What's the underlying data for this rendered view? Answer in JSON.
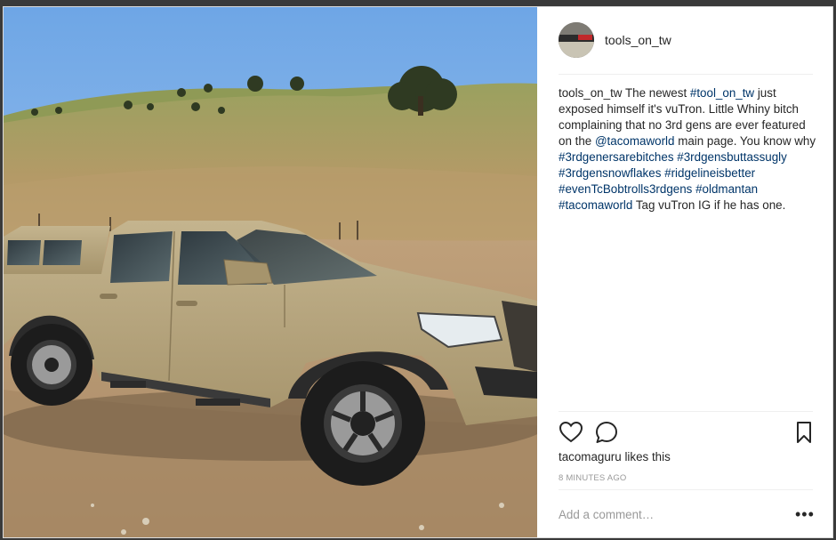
{
  "post": {
    "username": "tools_on_tw",
    "caption": [
      {
        "type": "user",
        "text": "tools_on_tw"
      },
      {
        "type": "text",
        "text": " The newest "
      },
      {
        "type": "link",
        "text": "#tool_on_tw"
      },
      {
        "type": "text",
        "text": " just exposed himself it's vuTron. Little Whiny bitch complaining that no 3rd gens are ever featured on the "
      },
      {
        "type": "link",
        "text": "@tacomaworld"
      },
      {
        "type": "text",
        "text": " main page. You know why "
      },
      {
        "type": "link",
        "text": "#3rdgenersarebitches"
      },
      {
        "type": "text",
        "text": " "
      },
      {
        "type": "link",
        "text": "#3rdgensbuttassugly"
      },
      {
        "type": "text",
        "text": " "
      },
      {
        "type": "link",
        "text": "#3rdgensnowflakes"
      },
      {
        "type": "text",
        "text": " "
      },
      {
        "type": "link",
        "text": "#ridgelineisbetter"
      },
      {
        "type": "text",
        "text": " "
      },
      {
        "type": "link",
        "text": "#evenTcBobtrolls3rdgens"
      },
      {
        "type": "text",
        "text": " "
      },
      {
        "type": "link",
        "text": "#oldmantan"
      },
      {
        "type": "text",
        "text": " "
      },
      {
        "type": "link",
        "text": "#tacomaworld"
      },
      {
        "type": "text",
        "text": " Tag vuTron IG if he has one."
      }
    ],
    "liked_by_user": "tacomaguru",
    "likes_suffix": " likes this",
    "timestamp": "8 MINUTES AGO",
    "comment_placeholder": "Add a comment…",
    "more_options": "•••"
  },
  "icons": {
    "like": "heart-icon",
    "comment": "comment-bubble-icon",
    "save": "bookmark-icon",
    "more": "more-options-icon"
  },
  "colors": {
    "link": "#003569",
    "text": "#262626",
    "muted": "#999999",
    "truck_body": "#b5a47e"
  }
}
